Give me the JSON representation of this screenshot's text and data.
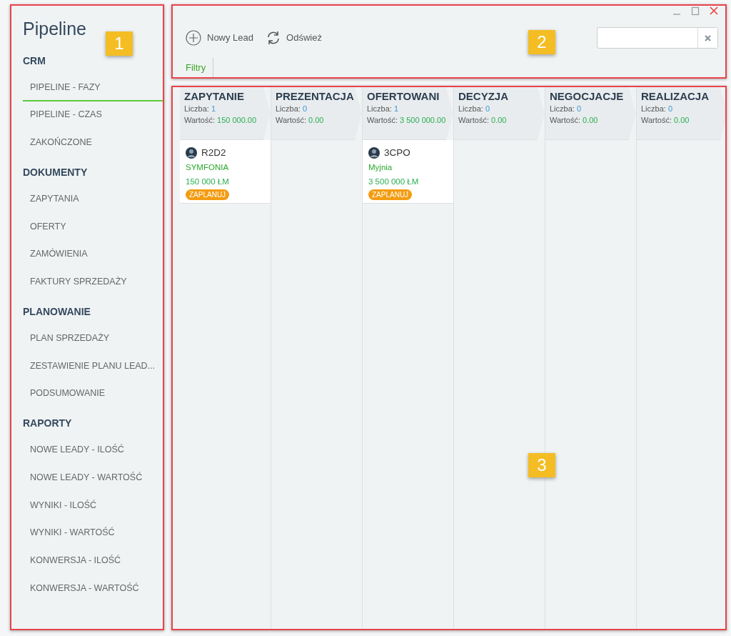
{
  "sidebar": {
    "title": "Pipeline",
    "sections": [
      {
        "heading": "CRM",
        "items": [
          {
            "label": "PIPELINE - FAZY",
            "selected": true
          },
          {
            "label": "PIPELINE - CZAS",
            "selected": false
          },
          {
            "label": "ZAKOŃCZONE",
            "selected": false
          }
        ]
      },
      {
        "heading": "DOKUMENTY",
        "items": [
          {
            "label": "ZAPYTANIA",
            "selected": false
          },
          {
            "label": "OFERTY",
            "selected": false
          },
          {
            "label": "ZAMÓWIENIA",
            "selected": false
          },
          {
            "label": "FAKTURY SPRZEDAŻY",
            "selected": false
          }
        ]
      },
      {
        "heading": "PLANOWANIE",
        "items": [
          {
            "label": "PLAN SPRZEDAŻY",
            "selected": false
          },
          {
            "label": "ZESTAWIENIE PLANU LEAD...",
            "selected": false
          },
          {
            "label": "PODSUMOWANIE",
            "selected": false
          }
        ]
      },
      {
        "heading": "RAPORTY",
        "items": [
          {
            "label": "NOWE LEADY - ILOŚĆ",
            "selected": false
          },
          {
            "label": "NOWE LEADY - WARTOŚĆ",
            "selected": false
          },
          {
            "label": "WYNIKI - ILOŚĆ",
            "selected": false
          },
          {
            "label": "WYNIKI - WARTOŚĆ",
            "selected": false
          },
          {
            "label": "KONWERSJA - ILOŚĆ",
            "selected": false
          },
          {
            "label": "KONWERSJA - WARTOŚĆ",
            "selected": false
          }
        ]
      }
    ]
  },
  "toolbar": {
    "buttons": [
      {
        "kind": "add",
        "label": "Nowy Lead"
      },
      {
        "kind": "refresh",
        "label": "Odśwież"
      }
    ],
    "tabs": [
      {
        "label": "Filtry",
        "selected": true
      }
    ]
  },
  "board": {
    "columns": [
      {
        "name": "ZAPYTANIE",
        "count_label": "Liczba:",
        "count": "1",
        "value_label": "Wartość:",
        "value": "150 000.00",
        "cards": [
          {
            "title": "R2D2",
            "company": "SYMFONIA",
            "value": "150 000 ŁM",
            "badge": "ZAPLANUJ"
          }
        ]
      },
      {
        "name": "PREZENTACJA",
        "count_label": "Liczba:",
        "count": "0",
        "value_label": "Wartość:",
        "value": "0.00"
      },
      {
        "name": "OFERTOWANI",
        "count_label": "Liczba:",
        "count": "1",
        "value_label": "Wartość:",
        "value": "3 500 000.00",
        "cards": [
          {
            "title": "3CPO",
            "company": "Myjnia",
            "value": "3 500 000 ŁM",
            "badge": "ZAPLANUJ"
          }
        ]
      },
      {
        "name": "DECYZJA",
        "count_label": "Liczba:",
        "count": "0",
        "value_label": "Wartość:",
        "value": "0.00"
      },
      {
        "name": "NEGOCJACJE",
        "count_label": "Liczba:",
        "count": "0",
        "value_label": "Wartość:",
        "value": "0.00"
      },
      {
        "name": "REALIZACJA",
        "count_label": "Liczba:",
        "count": "0",
        "value_label": "Wartość:",
        "value": "0.00"
      }
    ]
  },
  "callouts": [
    {
      "number": "1"
    },
    {
      "number": "2"
    },
    {
      "number": "3"
    }
  ]
}
